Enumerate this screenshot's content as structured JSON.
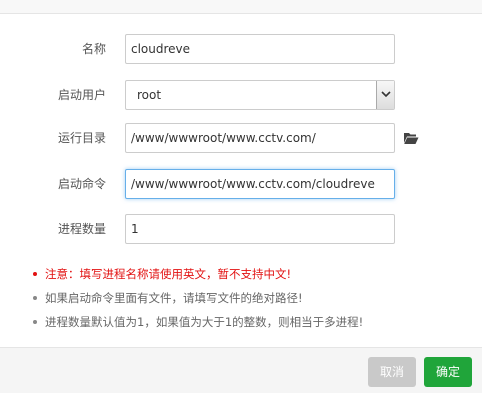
{
  "form": {
    "name": {
      "label": "名称",
      "value": "cloudreve"
    },
    "user": {
      "label": "启动用户",
      "selected": "root"
    },
    "dir": {
      "label": "运行目录",
      "value": "/www/wwwroot/www.cctv.com/"
    },
    "command": {
      "label": "启动命令",
      "value": "/www/wwwroot/www.cctv.com/cloudreve"
    },
    "count": {
      "label": "进程数量",
      "value": "1"
    }
  },
  "notes": [
    "注意：填写进程名称请使用英文，暂不支持中文!",
    "如果启动命令里面有文件，请填写文件的绝对路径!",
    "进程数量默认值为1，如果值为大于1的整数，则相当于多进程!"
  ],
  "buttons": {
    "cancel": "取消",
    "ok": "确定"
  },
  "colors": {
    "warning": "#e21111",
    "primary": "#20a53a",
    "disabled": "#c9c9c9",
    "focus": "#66afe9"
  },
  "icons": {
    "browse": "folder-open-icon",
    "dropdown": "chevron-down-icon"
  }
}
